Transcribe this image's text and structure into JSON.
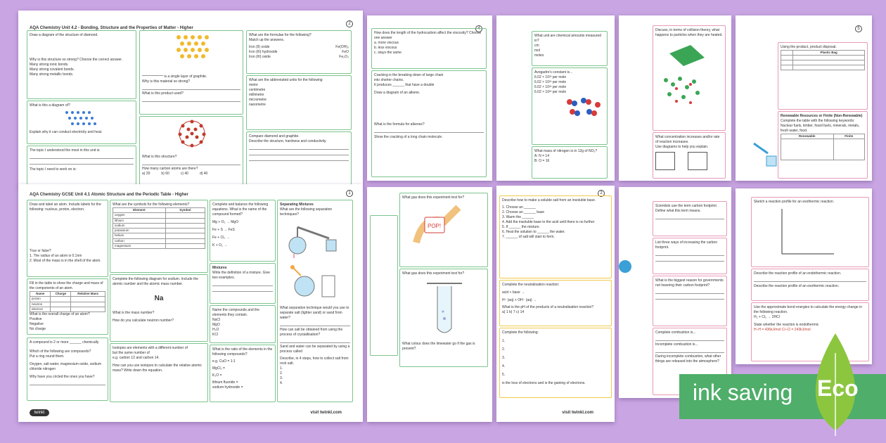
{
  "sheet1": {
    "header": "AQA Chemistry Unit 4.2 - Bonding, Structure and the Properties of Matter - Higher",
    "q1": "Draw a diagram of the structure of diamond.",
    "q2": "Why is this structure so strong? Choose the correct answer.",
    "q2_options": [
      "Many strong ionic bonds.",
      "Many strong covalent bonds.",
      "Many strong metallic bonds."
    ],
    "q3": "What is this a diagram of?",
    "q4": "Explain why it can conduct electricity and heat.",
    "q5": "The topic I understood the most in this unit is:",
    "q6": "The topic I need to work on is:",
    "graphite_label": "is a single layer of graphite.",
    "graphite_q": "Why is this material so strong?",
    "product_q": "What is this product used?",
    "structure_q": "What is this structure?",
    "carbon_q": "How many carbon atoms are there?",
    "carbon_opts": [
      "a) 20",
      "b) 60",
      "c) 40",
      "d) 40"
    ],
    "formula_q": "What are the formulae for the following?",
    "formula_sub": "Match up the answers.",
    "formula_rows": [
      "Iron (II) oxide",
      "Iron (III) hydroxide",
      "Iron (III) oxide"
    ],
    "formula_ans": [
      "Fe(OH)₃",
      "FeO",
      "Fe₂O₃"
    ],
    "abbr_q": "What are the abbreviated units for the following",
    "abbr_rows": [
      "metre",
      "centimetre",
      "millimetre",
      "micrometre",
      "nanometre"
    ],
    "compare_q": "Compare diamond and graphite.",
    "compare_sub": "Describe the structure, hardness and conductivity."
  },
  "sheet2": {
    "q1": "How does the length of the hydrocarbon affect the viscosity? Choose one answer",
    "q1_opts": [
      "a. more viscous",
      "b. less viscous",
      "c. stays the same"
    ],
    "q2": "Cracking is the breaking down of large chain",
    "q2b": "into shorter chains.",
    "q2c": "It produces",
    "q2d": "that have a double",
    "q3": "Draw a diagram of an alkene.",
    "q4": "What is the formula for alkenes?",
    "q5": "Show the cracking of a long chain molecule."
  },
  "sheet3": {
    "q1": "What unit are chemical amounts measured in?",
    "q1_opts": [
      "cm",
      "mol",
      "moles"
    ],
    "q2": "Avogadro's constant is...",
    "q2_opts": [
      "6.02 × 10²³ per mole",
      "6.02 × 10²³ per mole",
      "6.02 × 10²³ per mole",
      "6.02 × 10²³ per mole"
    ],
    "q3": "What mass of nitrogen is in 12g of NO₂?",
    "q3_opts": [
      "A: N = 14",
      "B: O = 16"
    ]
  },
  "sheet4": {
    "q1": "Discuss, in terms of collision theory, what happens to particles when they are heated.",
    "q2": "What concentration increases and/or rate of reaction increases.",
    "q2b": "Use diagrams to help you explain."
  },
  "sheet5": {
    "q1": "Using the product, product disposal.",
    "table_header": "Plastic Bag",
    "q2": "Renewable Resources or Finite (Non-Renewable)",
    "q2b": "Complete the table with the following keywords: Nuclear fuels, timber, fossil fuels, minerals, metals, fresh water, food.",
    "col1": "Renewable",
    "col2": "Finite"
  },
  "sheet6": {
    "header": "AQA Chemistry GCSE Unit 4.1 Atomic Structure and the Periodic Table - Higher",
    "q1": "Draw and label an atom. Include labels for the following: nucleus, proton, electron.",
    "true_false": "True or false?",
    "tf1": "1. The radius of an atom is 0.1nm",
    "tf2": "2. Most of the mass is in the shell of the atom.",
    "q2": "Fill in the table to show the charge and mass of the components of an atom.",
    "table_cols": [
      "Name",
      "Charge",
      "Relative Mass"
    ],
    "table_rows": [
      "proton",
      "neutron",
      "electron"
    ],
    "q3": "What is the overall charge of an atom?",
    "q3_opts": [
      "Positive",
      "Negative",
      "No charge"
    ],
    "q4": "A compound is 2 or more",
    "q4b": "chemically",
    "q5": "Which of the following are compounds?",
    "q5b": "Put a ring round them.",
    "q5c": "Oxygen, salt water, magnesium oxide, sodium chloride nitrogen",
    "q5d": "Why have you circled the ones you have?",
    "symbol_q": "What are the symbols for the following elements?",
    "symbol_cols": [
      "Element",
      "Symbol"
    ],
    "symbol_rows": [
      "oxygen",
      "lithium",
      "sodium",
      "potassium",
      "helium",
      "carbon",
      "magnesium"
    ],
    "diagram_q": "Complete the following diagram for sodium. Include the atomic number and the atomic mass number.",
    "sodium": "Na",
    "mass_q": "What is the mass number?",
    "neutron_q": "How do you calculate neutron number?",
    "isotope_q": "Isotopes are elements with a different number of",
    "isotope_q2": "but the same number of",
    "isotope_q3": "e.g. carbon 12 and carbon 14.",
    "isotope_q4": "How can you use isotopes to calculate the relative atomic mass? Write down the equation.",
    "balance_q": "Complete and balance the following equations. What is the name of the compound formed?",
    "balance_rows": [
      "Mg + O₂ → MgO",
      "Fe + S → FeS",
      "Fe + Cl₂ →",
      "K + O₂ →"
    ],
    "mix_title": "Mixtures",
    "mix_q": "Write the definition of a mixture. Give two examples.",
    "name_q": "Name the compounds and the elements they contain.",
    "name_rows": [
      "NaCl",
      "MgO",
      "H₂O",
      "KCl"
    ],
    "ratio_q": "What is the ratio of the elements in the following compounds?",
    "ratio_eg": "e.g. CuO = 1:1",
    "ratio_rows": [
      "MgCl₂ =",
      "K₂O ="
    ],
    "ratio_rows2": [
      "lithium fluoride =",
      "sodium hydroxide ="
    ],
    "sep_title": "Separating Mixtures",
    "sep_q": "What are the following separation techniques?",
    "sep_q2": "What separation technique would you use to separate salt (lighter sand) or sand from water?",
    "sep_q3": "How can salt be obtained from using the process of crystallisation?",
    "sep_q4": "Sand and water can be separated by using a process called",
    "sep_q5": "Describe, in 4 steps, how to collect salt from rock salt.",
    "steps": [
      "1.",
      "2.",
      "3.",
      "4."
    ],
    "footer": "visit twinkl.com",
    "logo": "twinkl"
  },
  "sheet7": {
    "q1": "What gas does this experiment test for?",
    "pop": "POP!",
    "q2": "What gas does this experiment test for?",
    "q3": "What colour does the limewater go if the gas is present?"
  },
  "sheet8": {
    "q1": "Describe how to make a soluble salt from an insoluble base.",
    "steps": [
      "1.   Choose an",
      "2.   Choose an",
      "3.   Warm the",
      "4.   Add the insoluble base to the acid until there is no further",
      "5.   If",
      "6.   Heat the solution to",
      "7.",
      "8.   Leave the"
    ],
    "steps_b": [
      "",
      "base",
      "",
      "",
      "the mixture.",
      "the water.",
      "of salt will start to form.",
      ""
    ],
    "q2": "Complete the neutralisation reaction:",
    "q2a": "acid + base →",
    "q2b": "H⁺ (aq) + OH⁻ (aq) →",
    "q3": "What is the pH of the products of a neutralisation reaction?",
    "q3_opts": "a) 1   b) 7   c) 14",
    "q4": "Complete the following:",
    "q4_rows": [
      "1.",
      "2.",
      "3.",
      "4.",
      "5."
    ],
    "q5": "is the loss of electrons and",
    "q5b": "is the gaining of electrons.",
    "footer": "visit twinkl.com"
  },
  "sheet9": {
    "q1": "Scientists use the term carbon footprint. Define what this term means.",
    "q2": "List three ways of increasing the carbon footprint.",
    "q3": "What is the biggest reason for governments not lowering their carbon footprint?",
    "q4": "Complete combustion is...",
    "q5": "Incomplete combustion is...",
    "q6": "During incomplete combustion, what other things are released into the atmosphere?"
  },
  "sheet10": {
    "q1": "Sketch a reaction profile for an exothermic reaction.",
    "q2": "Describe the reaction profile of an endothermic reaction.",
    "q3": "Describe the reaction profile of an exothermic reaction.",
    "q4": "Use the approximate bond energies to calculate the energy change in the following reaction.",
    "q4b": "H₂ + Cl₂ → 2HCl",
    "q5": "State whether the reaction is endothermic",
    "q5b": "H–H = 436kJ/mol   Cl–Cl = 243kJ/mol"
  },
  "banner": {
    "text": "ink saving",
    "eco": "Eco"
  },
  "colors": {
    "background": "#c9a6e3",
    "green_border": "#7cc48e",
    "yellow_border": "#f2c94c",
    "pink_border": "#e89ab8",
    "banner": "#4fae6a"
  }
}
